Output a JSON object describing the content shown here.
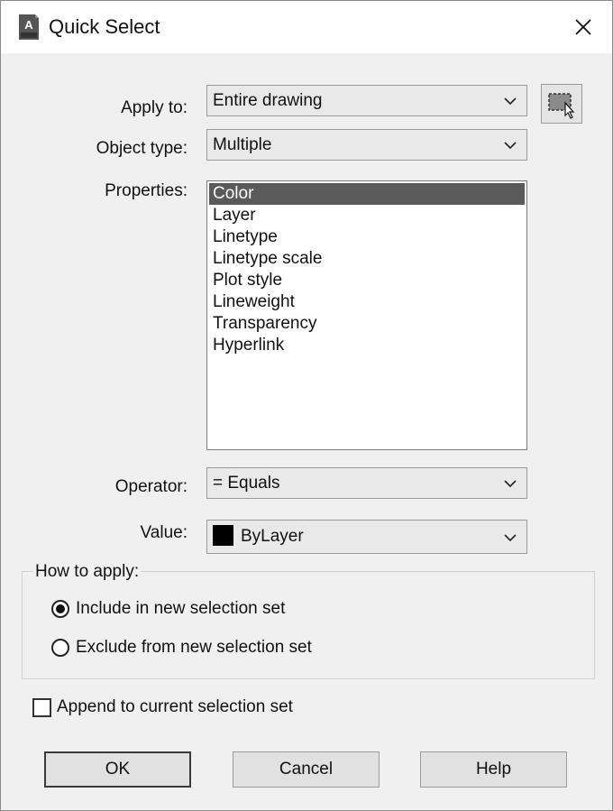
{
  "window": {
    "title": "Quick Select",
    "icon": "autocad-app-icon",
    "close_icon": "close-icon"
  },
  "apply_to": {
    "label": "Apply to:",
    "value": "Entire drawing"
  },
  "object_type": {
    "label": "Object type:",
    "value": "Multiple"
  },
  "properties": {
    "label": "Properties:",
    "items": [
      "Color",
      "Layer",
      "Linetype",
      "Linetype scale",
      "Plot style",
      "Lineweight",
      "Transparency",
      "Hyperlink"
    ],
    "selected_index": 0
  },
  "operator": {
    "label": "Operator:",
    "value": "= Equals"
  },
  "value": {
    "label": "Value:",
    "value": "ByLayer",
    "swatch_color": "#000000"
  },
  "how_to_apply": {
    "title": "How to apply:",
    "options": [
      {
        "label": "Include in new selection set",
        "checked": true
      },
      {
        "label": "Exclude from new selection set",
        "checked": false
      }
    ]
  },
  "append": {
    "label": "Append to current selection set",
    "checked": false
  },
  "buttons": {
    "ok": "OK",
    "cancel": "Cancel",
    "help": "Help"
  }
}
